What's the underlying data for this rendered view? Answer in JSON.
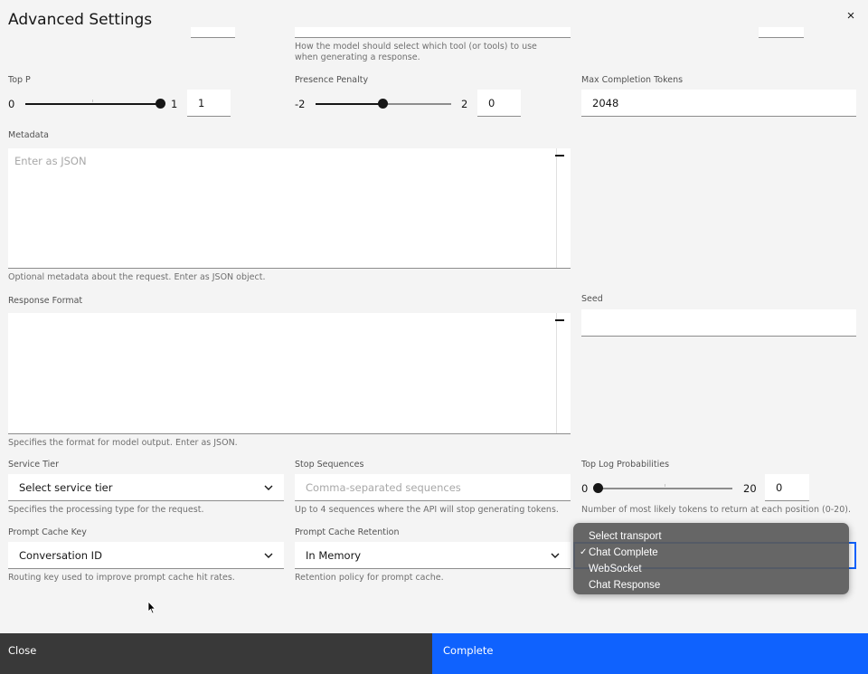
{
  "dialog": {
    "title": "Advanced Settings"
  },
  "top_clipped": {
    "tool_choice_helper": "How the model should select which tool (or tools) to use when generating a response."
  },
  "top_p": {
    "label": "Top P",
    "min": "0",
    "max": "1",
    "value": "1",
    "fraction": 1.0
  },
  "presence_penalty": {
    "label": "Presence Penalty",
    "min": "-2",
    "max": "2",
    "value": "0",
    "fraction": 0.5
  },
  "max_completion_tokens": {
    "label": "Max Completion Tokens",
    "value": "2048"
  },
  "metadata": {
    "label": "Metadata",
    "placeholder": "Enter as JSON",
    "helper": "Optional metadata about the request. Enter as JSON object."
  },
  "response_format": {
    "label": "Response Format",
    "helper": "Specifies the format for model output. Enter as JSON."
  },
  "seed": {
    "label": "Seed",
    "value": ""
  },
  "service_tier": {
    "label": "Service Tier",
    "value": "Select service tier",
    "helper": "Specifies the processing type for the request."
  },
  "stop_sequences": {
    "label": "Stop Sequences",
    "placeholder": "Comma-separated sequences",
    "helper": "Up to 4 sequences where the API will stop generating tokens."
  },
  "top_log_probabilities": {
    "label": "Top Log Probabilities",
    "min": "0",
    "max": "20",
    "value": "0",
    "fraction": 0.0,
    "helper": "Number of most likely tokens to return at each position (0-20)."
  },
  "prompt_cache_key": {
    "label": "Prompt Cache Key",
    "value": "Conversation ID",
    "helper": "Routing key used to improve prompt cache hit rates."
  },
  "prompt_cache_retention": {
    "label": "Prompt Cache Retention",
    "value": "In Memory",
    "helper": "Retention policy for prompt cache."
  },
  "transport_dropdown": {
    "options": [
      "Select transport",
      "Chat Complete",
      "WebSocket",
      "Chat Response"
    ],
    "selected": "Chat Complete",
    "check": "✓"
  },
  "footer": {
    "close_label": "Close",
    "complete_label": "Complete"
  },
  "icons": {
    "close": "×",
    "chevron": "chevron-down-icon",
    "cursor": "mouse-pointer-icon"
  }
}
